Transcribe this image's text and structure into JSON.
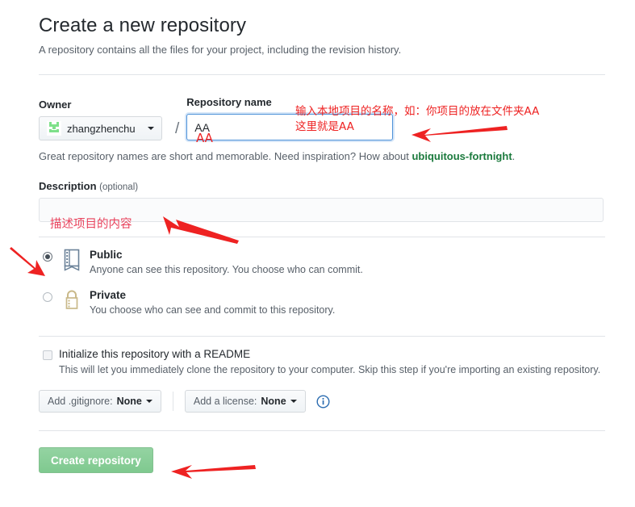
{
  "page": {
    "title": "Create a new repository",
    "subtitle": "A repository contains all the files for your project, including the revision history."
  },
  "owner": {
    "label": "Owner",
    "name": "zhangzhenchu",
    "separator": "/"
  },
  "repository_name": {
    "label": "Repository name",
    "value": "AA",
    "placeholder": ""
  },
  "hint": {
    "prefix": "Great repository names are short and memorable. Need inspiration? How about ",
    "suggestion": "ubiquitous-fortnight",
    "suffix": "."
  },
  "description": {
    "label": "Description",
    "optional": "(optional)",
    "value": "",
    "placeholder": ""
  },
  "visibility": {
    "options": [
      {
        "title": "Public",
        "desc": "Anyone can see this repository. You choose who can commit.",
        "selected": true,
        "icon": "repo-book-icon"
      },
      {
        "title": "Private",
        "desc": "You choose who can see and commit to this repository.",
        "selected": false,
        "icon": "lock-icon"
      }
    ]
  },
  "readme": {
    "label": "Initialize this repository with a README",
    "desc": "This will let you immediately clone the repository to your computer. Skip this step if you're importing an existing repository.",
    "checked": false
  },
  "selects": {
    "gitignore": {
      "prefix": "Add .gitignore: ",
      "value": "None"
    },
    "license": {
      "prefix": "Add a license: ",
      "value": "None"
    },
    "info_icon": "info-icon"
  },
  "actions": {
    "create_label": "Create repository"
  },
  "annotations": {
    "repo_name_note": "输入本地项目的名称，如：你项目的放在文件夹AA\n这里就是AA",
    "repo_name_value": "AA",
    "description_note": "描述项目的内容"
  },
  "colors": {
    "annotation_red": "#ee2222",
    "suggestion_green": "#1b7a3d",
    "focus_blue": "#4f93d9",
    "create_green": "#7fc98f"
  }
}
